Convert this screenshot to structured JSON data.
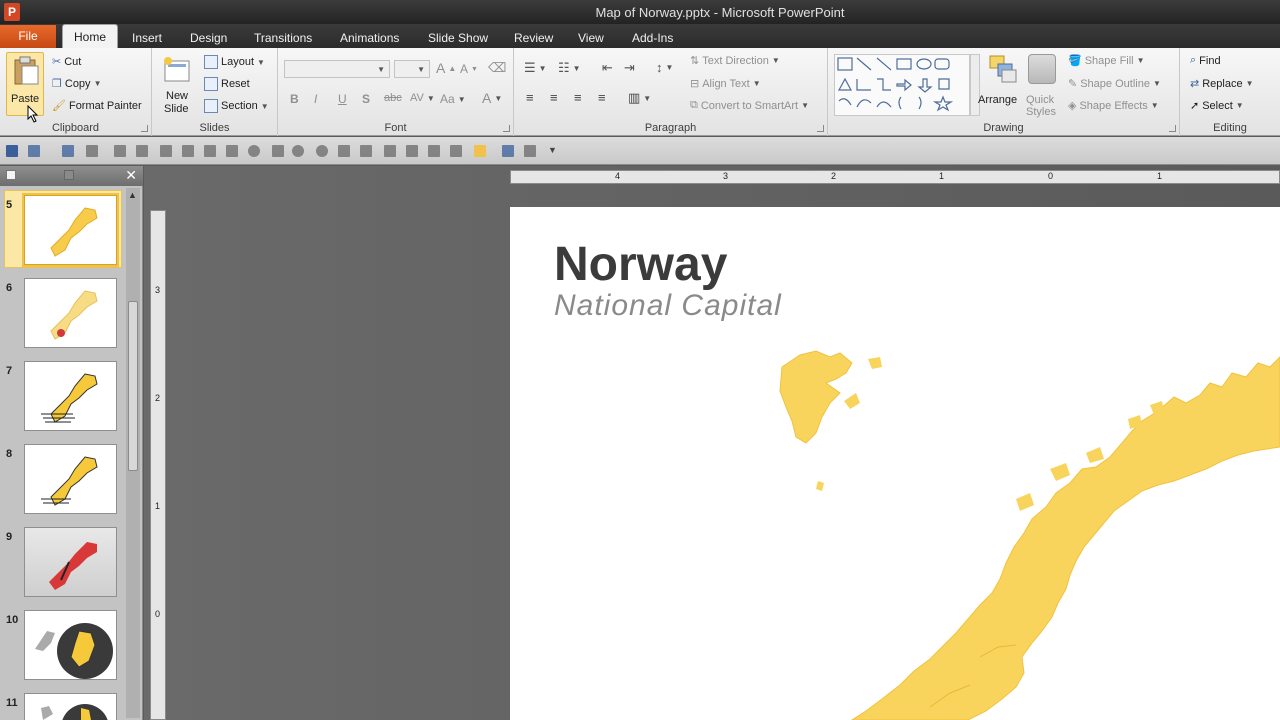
{
  "window": {
    "title": "Map of Norway.pptx  -  Microsoft PowerPoint",
    "app_icon": "P"
  },
  "tabs": [
    {
      "label": "File"
    },
    {
      "label": "Home"
    },
    {
      "label": "Insert"
    },
    {
      "label": "Design"
    },
    {
      "label": "Transitions"
    },
    {
      "label": "Animations"
    },
    {
      "label": "Slide Show"
    },
    {
      "label": "Review"
    },
    {
      "label": "View"
    },
    {
      "label": "Add-Ins"
    }
  ],
  "ribbon": {
    "clipboard": {
      "label": "Clipboard",
      "paste": "Paste",
      "cut": "Cut",
      "copy": "Copy",
      "format_painter": "Format Painter"
    },
    "slides": {
      "label": "Slides",
      "new_slide_1": "New",
      "new_slide_2": "Slide",
      "layout": "Layout",
      "reset": "Reset",
      "section": "Section"
    },
    "font": {
      "label": "Font"
    },
    "paragraph": {
      "label": "Paragraph",
      "text_direction": "Text Direction",
      "align_text": "Align Text",
      "convert_smartart": "Convert to SmartArt"
    },
    "drawing": {
      "label": "Drawing",
      "arrange": "Arrange",
      "quick_styles_1": "Quick",
      "quick_styles_2": "Styles",
      "shape_fill": "Shape Fill",
      "shape_outline": "Shape Outline",
      "shape_effects": "Shape Effects"
    },
    "editing": {
      "label": "Editing",
      "find": "Find",
      "replace": "Replace",
      "select": "Select"
    }
  },
  "ruler": {
    "h": [
      "4",
      "3",
      "2",
      "1",
      "0",
      "1"
    ],
    "v": [
      "3",
      "2",
      "1",
      "0"
    ]
  },
  "slides_panel": {
    "items": [
      {
        "num": "5",
        "selected": true
      },
      {
        "num": "6"
      },
      {
        "num": "7"
      },
      {
        "num": "8"
      },
      {
        "num": "9"
      },
      {
        "num": "10"
      },
      {
        "num": "11"
      }
    ]
  },
  "slide": {
    "title": "Norway",
    "subtitle": "National Capital"
  },
  "colors": {
    "map_fill": "#f9d45c",
    "file_tab": "#d9531e",
    "selection": "#f0c24a"
  }
}
